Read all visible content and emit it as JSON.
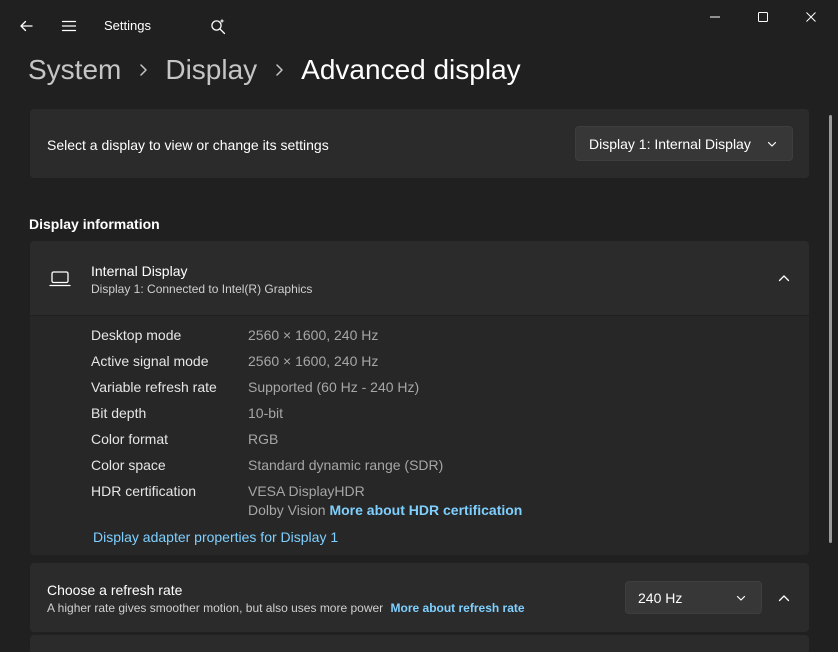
{
  "window": {
    "app_title": "Settings",
    "controls": {
      "minimize": "minimize",
      "maximize": "maximize",
      "close": "close"
    }
  },
  "breadcrumb": {
    "items": [
      "System",
      "Display"
    ],
    "current": "Advanced display"
  },
  "display_selector": {
    "label": "Select a display to view or change its settings",
    "selected": "Display 1: Internal Display"
  },
  "display_information": {
    "section_title": "Display information",
    "name": "Internal Display",
    "subtitle": "Display 1: Connected to Intel(R) Graphics",
    "specs": [
      {
        "label": "Desktop mode",
        "value": "2560 × 1600, 240 Hz"
      },
      {
        "label": "Active signal mode",
        "value": "2560 × 1600, 240 Hz"
      },
      {
        "label": "Variable refresh rate",
        "value": "Supported (60 Hz - 240 Hz)"
      },
      {
        "label": "Bit depth",
        "value": "10-bit"
      },
      {
        "label": "Color format",
        "value": "RGB"
      },
      {
        "label": "Color space",
        "value": "Standard dynamic range (SDR)"
      },
      {
        "label": "HDR certification",
        "value": "VESA DisplayHDR",
        "value2": "Dolby Vision",
        "link": "More about HDR certification"
      }
    ],
    "adapter_link": "Display adapter properties for Display 1"
  },
  "refresh_rate": {
    "title": "Choose a refresh rate",
    "description": "A higher rate gives smoother motion, but also uses more power",
    "link": "More about refresh rate",
    "selected": "240 Hz"
  },
  "colors": {
    "background": "#202020",
    "card": "#2b2b2b",
    "link": "#7fd0ff"
  }
}
